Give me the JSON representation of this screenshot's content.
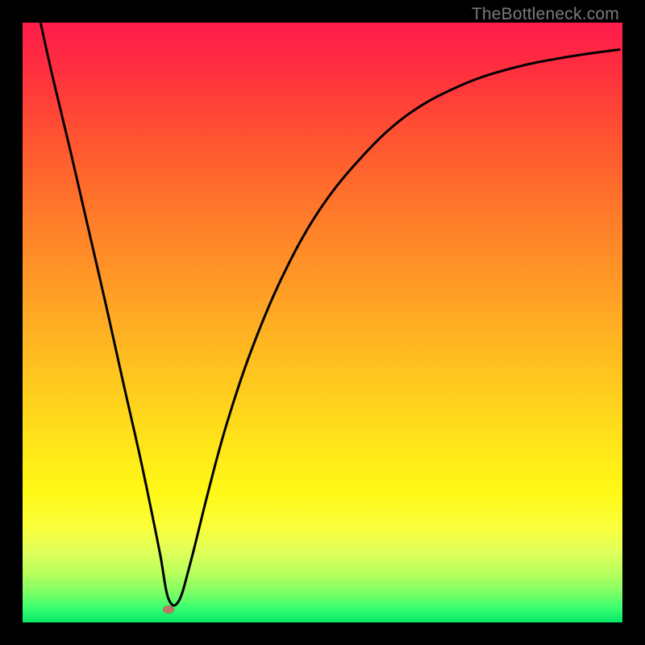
{
  "watermark": "TheBottleneck.com",
  "chart_data": {
    "type": "line",
    "title": "",
    "xlabel": "",
    "ylabel": "",
    "xlim": [
      0,
      100
    ],
    "ylim": [
      0,
      100
    ],
    "series": [
      {
        "name": "curve",
        "x": [
          3,
          5,
          8,
          11,
          14,
          17,
          19.5,
          21.5,
          23,
          24.3,
          26,
          28,
          31,
          34,
          38,
          43,
          49,
          56,
          64,
          73,
          82,
          91,
          99.5
        ],
        "values": [
          100,
          91,
          78.5,
          65.5,
          52.5,
          39,
          28,
          18.5,
          11,
          4,
          3.5,
          10,
          22,
          33,
          45,
          57,
          68,
          77,
          84.5,
          89.5,
          92.5,
          94.3,
          95.5
        ]
      }
    ],
    "marker": {
      "x": 24.3,
      "y": 2.2,
      "name": "minimum-point"
    },
    "background_gradient": {
      "top": "#ff1c4b",
      "bottom": "#06e767"
    }
  }
}
